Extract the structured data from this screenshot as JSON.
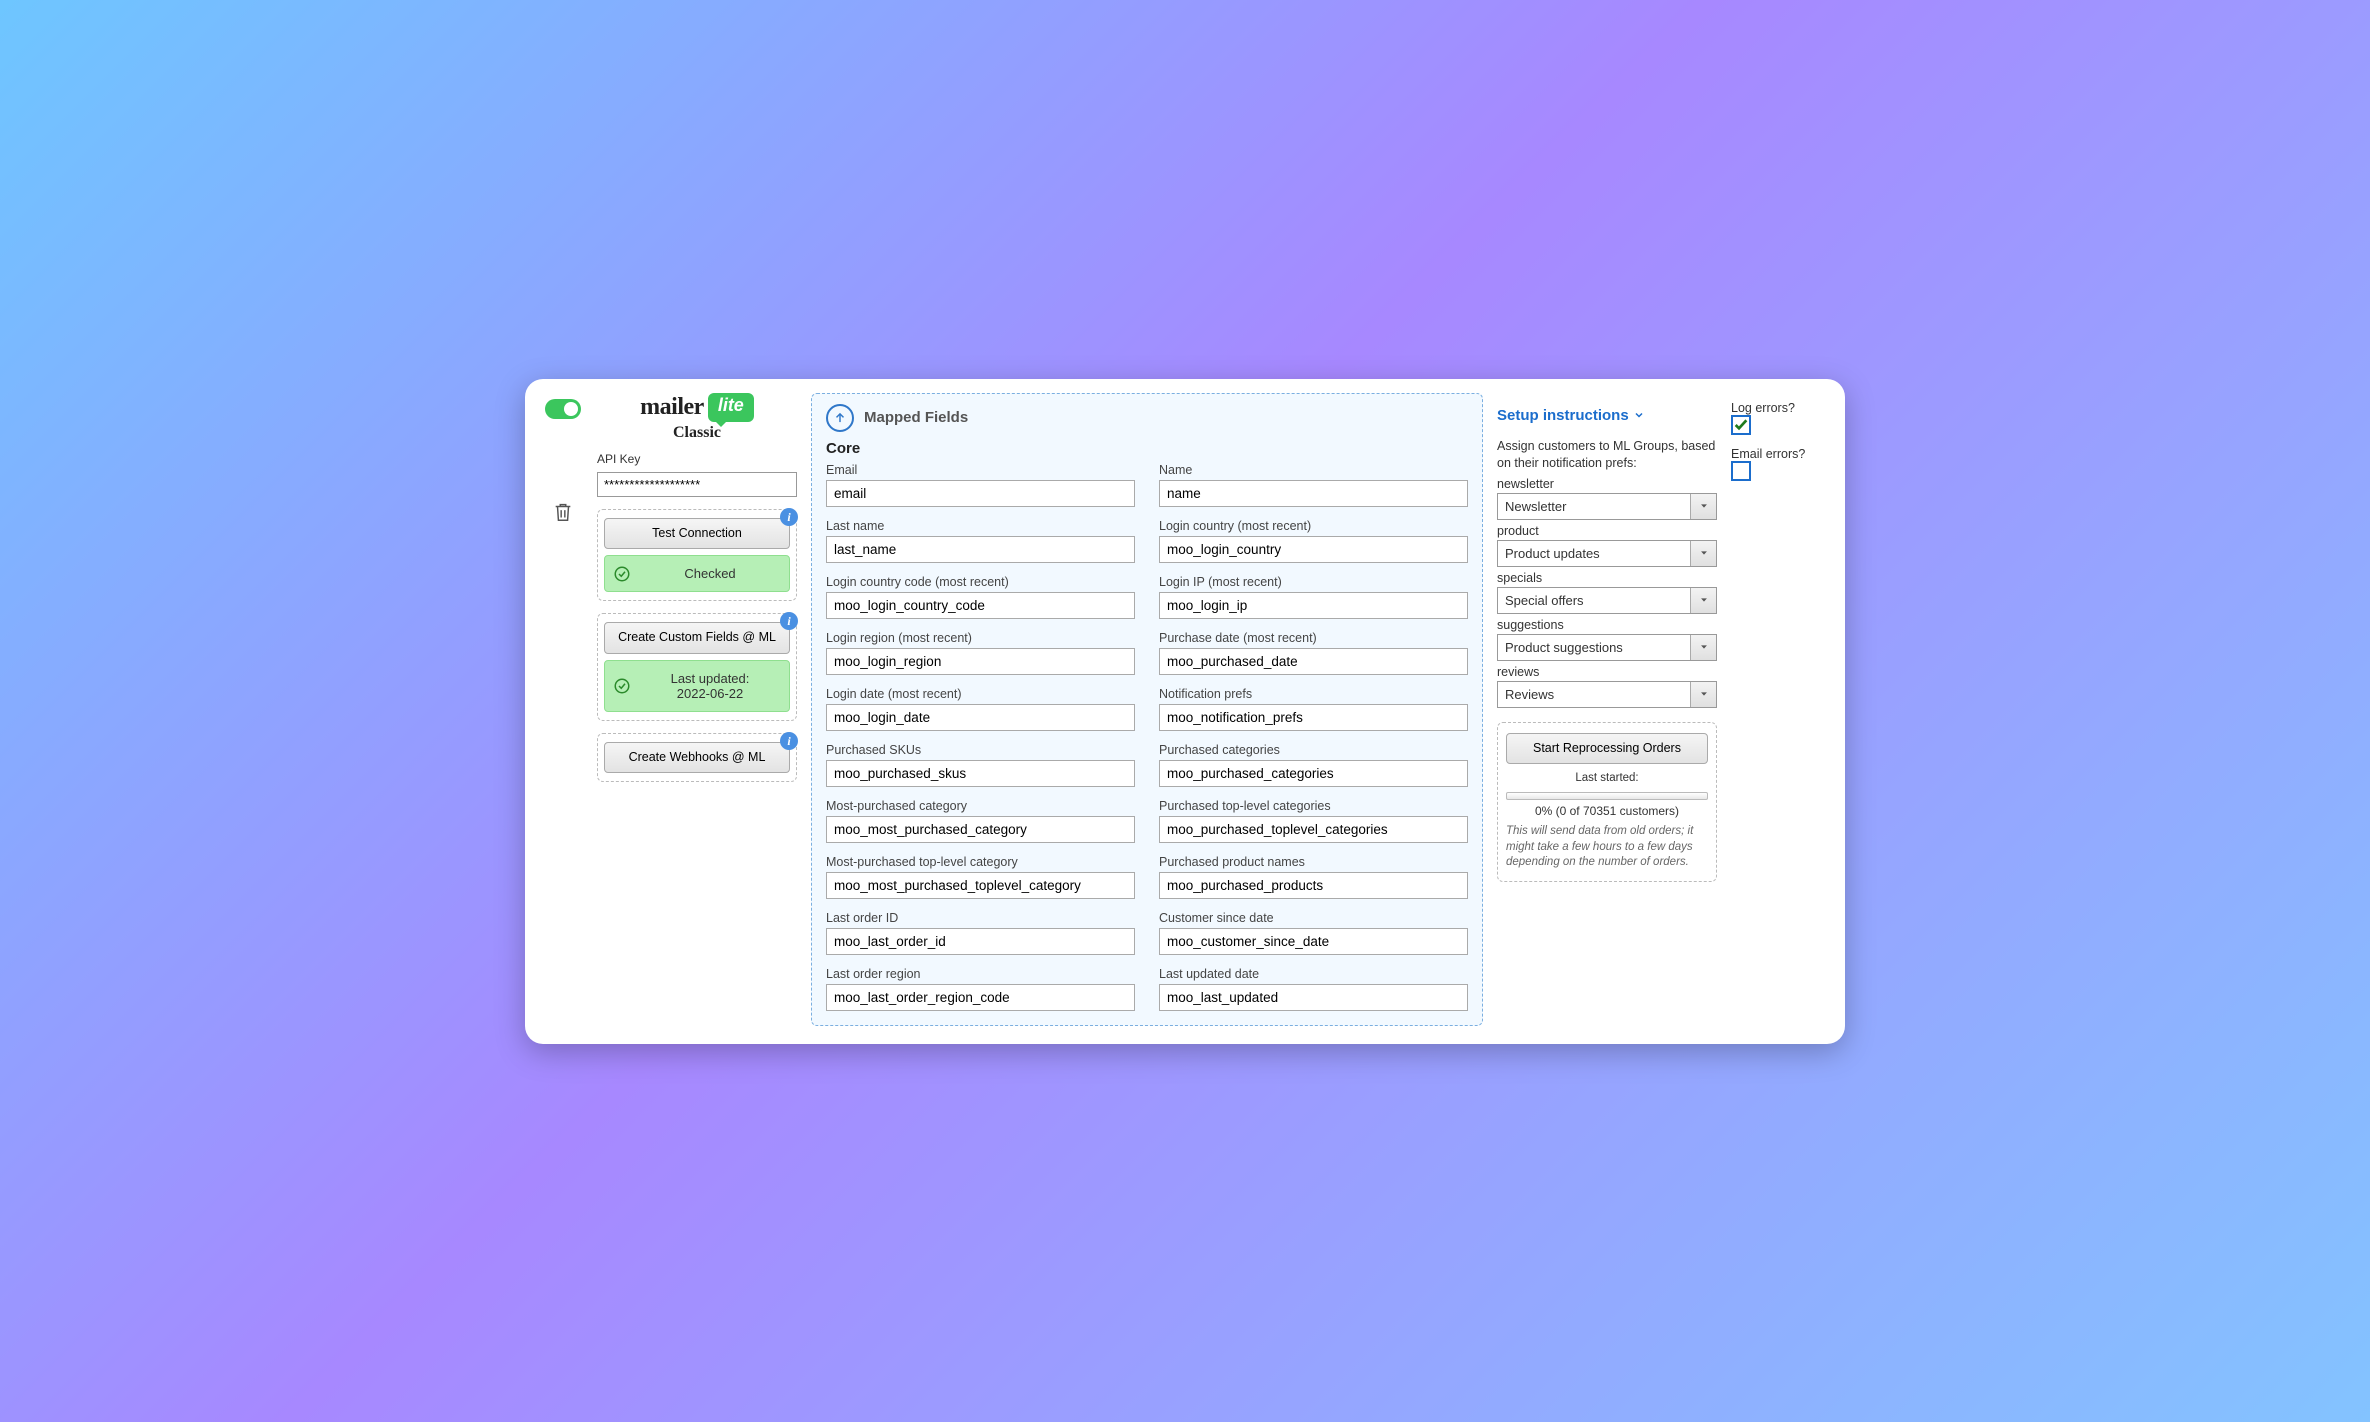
{
  "logo": {
    "brand": "mailer",
    "badge": "lite",
    "edition": "Classic"
  },
  "api": {
    "label": "API Key",
    "value": "*******************"
  },
  "sidebar": {
    "test_btn": "Test Connection",
    "checked_status": "Checked",
    "create_fields_btn": "Create Custom Fields @ ML",
    "last_updated_label": "Last updated:",
    "last_updated_date": "2022-06-22",
    "create_webhooks_btn": "Create Webhooks @ ML"
  },
  "mapped": {
    "title": "Mapped Fields",
    "core_title": "Core",
    "fields": [
      {
        "label": "Email",
        "value": "email"
      },
      {
        "label": "Name",
        "value": "name"
      },
      {
        "label": "Last name",
        "value": "last_name"
      },
      {
        "label": "Login country (most recent)",
        "value": "moo_login_country"
      },
      {
        "label": "Login country code (most recent)",
        "value": "moo_login_country_code"
      },
      {
        "label": "Login IP (most recent)",
        "value": "moo_login_ip"
      },
      {
        "label": "Login region (most recent)",
        "value": "moo_login_region"
      },
      {
        "label": "Purchase date (most recent)",
        "value": "moo_purchased_date"
      },
      {
        "label": "Login date (most recent)",
        "value": "moo_login_date"
      },
      {
        "label": "Notification prefs",
        "value": "moo_notification_prefs"
      },
      {
        "label": "Purchased SKUs",
        "value": "moo_purchased_skus"
      },
      {
        "label": "Purchased categories",
        "value": "moo_purchased_categories"
      },
      {
        "label": "Most-purchased category",
        "value": "moo_most_purchased_category"
      },
      {
        "label": "Purchased top-level categories",
        "value": "moo_purchased_toplevel_categories"
      },
      {
        "label": "Most-purchased top-level category",
        "value": "moo_most_purchased_toplevel_category"
      },
      {
        "label": "Purchased product names",
        "value": "moo_purchased_products"
      },
      {
        "label": "Last order ID",
        "value": "moo_last_order_id"
      },
      {
        "label": "Customer since date",
        "value": "moo_customer_since_date"
      },
      {
        "label": "Last order region",
        "value": "moo_last_order_region_code"
      },
      {
        "label": "Last updated date",
        "value": "moo_last_updated"
      }
    ]
  },
  "right": {
    "setup_link": "Setup instructions",
    "assign_desc": "Assign customers to ML Groups, based on their notification prefs:",
    "groups": [
      {
        "key": "newsletter",
        "value": "Newsletter"
      },
      {
        "key": "product",
        "value": "Product updates"
      },
      {
        "key": "specials",
        "value": "Special offers"
      },
      {
        "key": "suggestions",
        "value": "Product suggestions"
      },
      {
        "key": "reviews",
        "value": "Reviews"
      }
    ],
    "reprocess": {
      "btn": "Start Reprocessing Orders",
      "last_started": "Last started:",
      "progress": "0% (0 of 70351 customers)",
      "note": "This will send data from old orders; it might take a few hours to a few days depending on the number of orders."
    }
  },
  "checks": {
    "log_label": "Log errors?",
    "log_checked": true,
    "email_label": "Email errors?",
    "email_checked": false
  }
}
